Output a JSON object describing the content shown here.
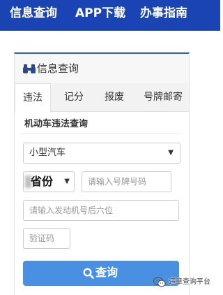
{
  "nav": {
    "items": [
      {
        "label": "信息查询"
      },
      {
        "label": "APP下载"
      },
      {
        "label": "办事指南"
      }
    ],
    "background": "#1a44b3"
  },
  "panel": {
    "title": "信息查询",
    "icon": "binoculars-icon",
    "accent": "#2f5fbf"
  },
  "tabs": [
    {
      "label": "违法",
      "active": true
    },
    {
      "label": "记分",
      "active": false
    },
    {
      "label": "报废",
      "active": false
    },
    {
      "label": "号牌邮寄",
      "active": false
    }
  ],
  "form": {
    "section_title": "机动车违法查询",
    "vehicle_type": {
      "selected": "小型汽车"
    },
    "province": {
      "selected": "省份"
    },
    "plate": {
      "placeholder": "请输入号牌号码",
      "value": ""
    },
    "engine": {
      "placeholder": "请输入发动机号后六位",
      "value": ""
    },
    "captcha": {
      "placeholder": "验证码",
      "value": ""
    },
    "submit": {
      "label": "查询",
      "icon": "search-icon",
      "color": "#4a90e2"
    }
  },
  "watermark": {
    "text": "违章查询平台",
    "icon": "wechat-icon"
  }
}
